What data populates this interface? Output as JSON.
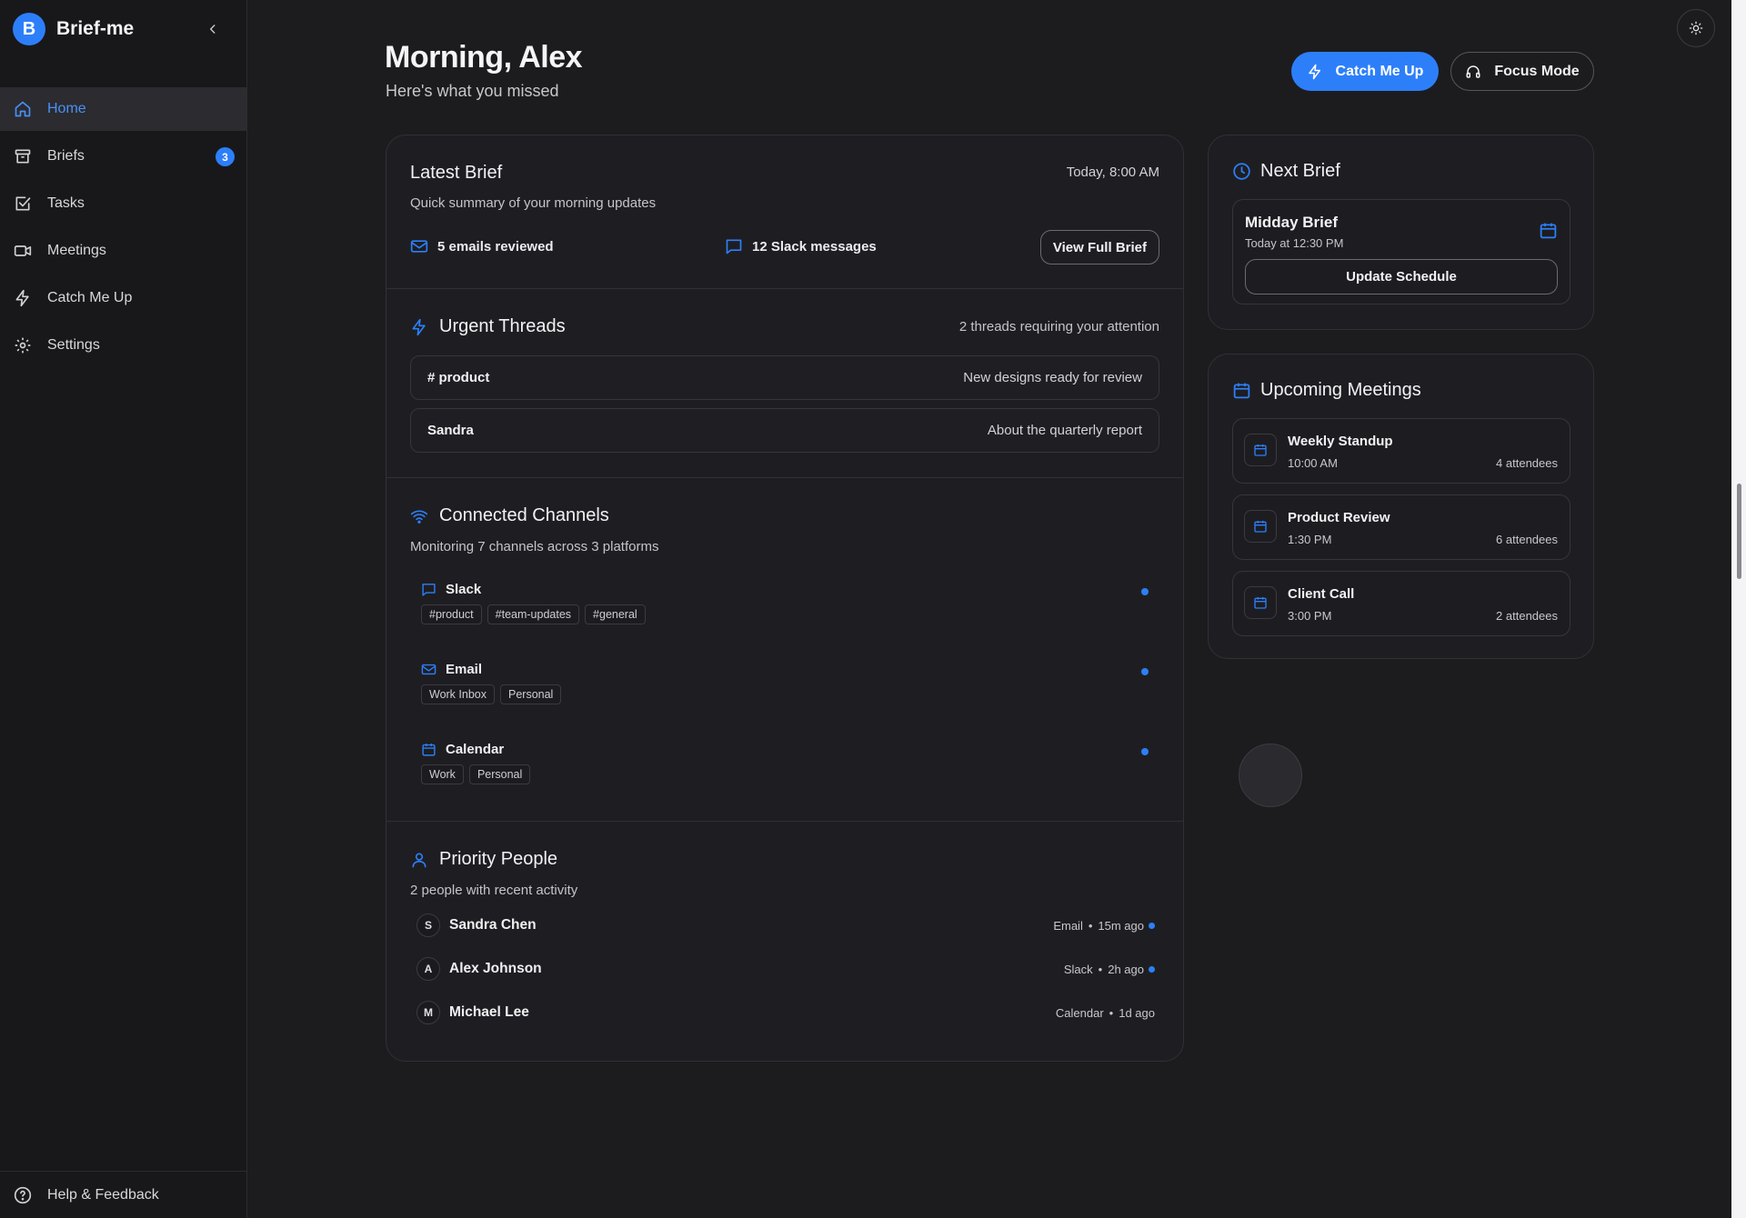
{
  "app": {
    "logo_letter": "B",
    "name": "Brief-me"
  },
  "sidebar": {
    "items": [
      {
        "label": "Home",
        "icon": "home-icon",
        "active": true
      },
      {
        "label": "Briefs",
        "icon": "archive-icon",
        "badge": "3"
      },
      {
        "label": "Tasks",
        "icon": "check-square-icon"
      },
      {
        "label": "Meetings",
        "icon": "video-icon"
      },
      {
        "label": "Catch Me Up",
        "icon": "lightning-icon"
      },
      {
        "label": "Settings",
        "icon": "gear-icon"
      }
    ],
    "footer": {
      "label": "Help & Feedback",
      "icon": "help-circle-icon"
    }
  },
  "header": {
    "greeting": "Morning, Alex",
    "subtitle": "Here's what you missed",
    "catch_up_label": "Catch Me Up",
    "focus_label": "Focus Mode"
  },
  "latest_brief": {
    "title": "Latest Brief",
    "time": "Today, 8:00 AM",
    "subtitle": "Quick summary of your morning updates",
    "emails": "5 emails reviewed",
    "slack": "12 Slack messages",
    "view_label": "View Full Brief"
  },
  "urgent": {
    "title": "Urgent Threads",
    "count_text": "2 threads requiring your attention",
    "threads": [
      {
        "name": "# product",
        "message": "New designs ready for review"
      },
      {
        "name": "Sandra",
        "message": "About the quarterly report"
      }
    ]
  },
  "channels": {
    "title": "Connected Channels",
    "subtitle": "Monitoring 7 channels across 3 platforms",
    "list": [
      {
        "name": "Slack",
        "tags": [
          "#product",
          "#team-updates",
          "#general"
        ]
      },
      {
        "name": "Email",
        "tags": [
          "Work Inbox",
          "Personal"
        ]
      },
      {
        "name": "Calendar",
        "tags": [
          "Work",
          "Personal"
        ]
      }
    ]
  },
  "people": {
    "title": "Priority People",
    "subtitle": "2 people with recent activity",
    "list": [
      {
        "initial": "S",
        "name": "Sandra Chen",
        "source": "Email",
        "sep": "•",
        "time": "15m ago",
        "active": true
      },
      {
        "initial": "A",
        "name": "Alex Johnson",
        "source": "Slack",
        "sep": "•",
        "time": "2h ago",
        "active": true
      },
      {
        "initial": "M",
        "name": "Michael Lee",
        "source": "Calendar",
        "sep": "•",
        "time": "1d ago",
        "active": false
      }
    ]
  },
  "next_brief": {
    "title": "Next Brief",
    "name": "Midday Brief",
    "time": "Today at 12:30 PM",
    "update_label": "Update Schedule"
  },
  "meetings": {
    "title": "Upcoming Meetings",
    "list": [
      {
        "title": "Weekly Standup",
        "time": "10:00 AM",
        "attendees": "4 attendees"
      },
      {
        "title": "Product Review",
        "time": "1:30 PM",
        "attendees": "6 attendees"
      },
      {
        "title": "Client Call",
        "time": "3:00 PM",
        "attendees": "2 attendees"
      }
    ]
  },
  "colors": {
    "accent": "#2d7ff9",
    "background": "#1c1c1f",
    "sidebar": "#18181b",
    "card": "#1e1e22"
  }
}
